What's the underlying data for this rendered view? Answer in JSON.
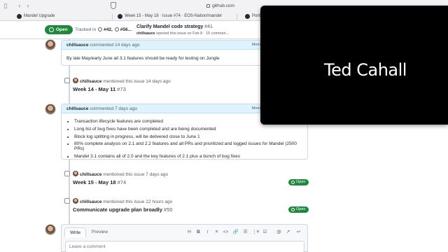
{
  "browser": {
    "url": "github.com",
    "tabs": [
      {
        "label": "Mandel Upgrade"
      },
      {
        "label": "Week 15 - May 18 · Issue #74 · EOS-Nation/mandel"
      },
      {
        "label": "Portf"
      }
    ]
  },
  "sticky": {
    "state": "Open",
    "tracked_label": "Tracked in",
    "tracked_1": "#42,",
    "tracked_2": "#56...",
    "title": "Clarify Mandel code strategy",
    "number": "#41",
    "meta_author": "chillsauce",
    "meta_rest": "opened this issue on Feb 8 · 15 commen..."
  },
  "timeline": {
    "comment1": {
      "author": "chillsauce",
      "action": "commented 14 days ago",
      "member_label": "Mem",
      "body": "By late May/early June all 3.1 features should be ready for testing on Jungle"
    },
    "ref1": {
      "author": "chillsauce",
      "action": "mentioned this issue 14 days ago",
      "title": "Week 14 - May 11",
      "number": "#73"
    },
    "comment2": {
      "author": "chillsauce",
      "action": "commented 7 days ago",
      "member_label": "Mem",
      "items": [
        "Transaction lifecycle features are completed",
        "Long list of bug fixes have been completed and are being documented",
        "Block log splitting in progress, will be delivered close to June 1",
        "80% complete analysis on 2.1 and 2.2 features and all PRs and prioritized and logged issues for Mandel (2500 PRs)",
        "Mandel 3.1 contains all of 2.0 and the key features of 2.1 plus a bunch of bug fixes"
      ]
    },
    "ref2": {
      "author": "chillsauce",
      "action": "mentioned this issue 7 days ago",
      "title": "Week 15 - May 18",
      "number": "#74",
      "state": "Open"
    },
    "ref3": {
      "author": "chillsauce",
      "action": "mentioned this issue 22 hours ago",
      "title": "Communicate upgrade plan broadly",
      "number": "#50",
      "state": "Open"
    }
  },
  "composer": {
    "write_tab": "Write",
    "preview_tab": "Preview",
    "placeholder": "Leave a comment",
    "tools": [
      "H",
      "B",
      "I",
      "≡",
      "<>",
      "🔗",
      "☰",
      "⋮≡",
      "☑",
      "@",
      "↗",
      "↩"
    ]
  },
  "overlay": {
    "name": "Ted Cahall"
  },
  "colors": {
    "open_green": "#1f883d",
    "comment_header_blue": "#ddf4ff",
    "overlay_black": "#000000"
  }
}
